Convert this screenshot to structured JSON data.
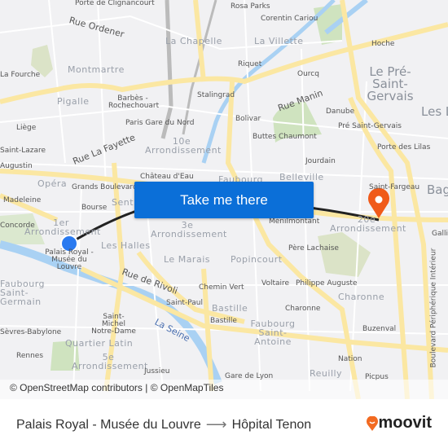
{
  "map": {
    "labels": [
      "Porte de Clignancourt",
      "Rosa Parks",
      "Corentin Cariou",
      "Rue Ordener",
      "La Chapelle",
      "La Villette",
      "Hoche",
      "Montmartre",
      "Riquet",
      "Ourcq",
      "Le Pré-Saint-Gervais",
      "La Fourche",
      "Pigalle",
      "Barbès - Rochechouart",
      "Stalingrad",
      "Rue Manin",
      "Danube",
      "Les L",
      "Bolivar",
      "Pré Saint-Gervais",
      "Liège",
      "Paris Gare du Nord",
      "Buttes Chaumont",
      "Porte des Lilas",
      "Rue La Fayette",
      "10e Arrondissement",
      "Saint-Lazare",
      "Jourdain",
      "Augustin",
      "Château d'Eau",
      "Faubourg",
      "Belleville",
      "Saint-Fargeau",
      "Opéra",
      "Grands Boulevards",
      "Madeleine",
      "Bourse",
      "Sentier",
      "Ménilmontant",
      "Bag",
      "1er Arrondissement",
      "Concorde",
      "3e Arrondissement",
      "20e Arrondissement",
      "Galliéni",
      "Palais Royal - Musée du Louvre",
      "Les Halles",
      "Père Lachaise",
      "Le Marais",
      "Popincourt",
      "Rue de Rivoli",
      "Chemin Vert",
      "Voltaire",
      "Philippe Auguste",
      "Faubourg Saint-Germain",
      "Saint-Paul",
      "Bastille",
      "Charonne",
      "Charonne",
      "Bastille",
      "Saint-Michel Notre-Dame",
      "Faubourg Saint-Antoine",
      "Sèvres-Babylone",
      "La Seine",
      "Buzenval",
      "Quartier Latin",
      "Rennes",
      "5e Arrondissement",
      "Jussieu",
      "Nation",
      "Reuilly",
      "Picpus",
      "Boulevard Périphérique Intérieur",
      "Gare de Lyon"
    ],
    "origin_color": "#2a7af0",
    "destination_color": "#f05a1a",
    "destination_icon": "map-pin-icon",
    "origin_icon": "origin-dot-icon"
  },
  "cta": {
    "label": "Take me there",
    "color": "#0b6fd8"
  },
  "attribution": "© OpenStreetMap contributors | © OpenMapTiles",
  "footer": {
    "origin": "Palais Royal - Musée du Louvre",
    "arrow_icon": "arrow-right-icon",
    "destination": "Hôpital Tenon",
    "logo": "moovit",
    "logo_color": "#f26a21"
  }
}
